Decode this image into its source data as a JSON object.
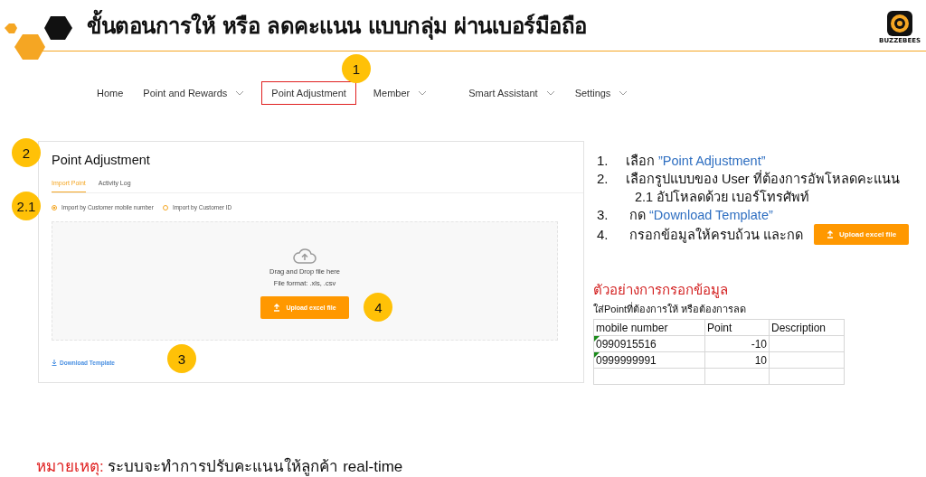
{
  "slide": {
    "title": "ขั้นตอนการให้ หรือ ลดคะแนน แบบกลุ่ม ผ่านเบอร์มือถือ",
    "logo": "BUZZEBEES"
  },
  "nav": [
    {
      "label": "Home",
      "dropdown": false,
      "highlighted": false
    },
    {
      "label": "Point and Rewards",
      "dropdown": true,
      "highlighted": false
    },
    {
      "label": "Point Adjustment",
      "dropdown": false,
      "highlighted": true,
      "callout": "1"
    },
    {
      "label": "Member",
      "dropdown": true,
      "highlighted": false
    },
    {
      "label": "Smart Assistant",
      "dropdown": true,
      "highlighted": false
    },
    {
      "label": "Settings",
      "dropdown": true,
      "highlighted": false
    }
  ],
  "panel": {
    "title": "Point Adjustment",
    "callout": "2",
    "tabs": [
      {
        "label": "Import Point",
        "selected": true
      },
      {
        "label": "Activity Log",
        "selected": false
      }
    ],
    "import_options": {
      "callout": "2.1",
      "options": [
        {
          "label": "Import by Customer mobile number",
          "selected": true
        },
        {
          "label": "Import by Customer ID",
          "selected": false
        }
      ]
    },
    "dropzone": {
      "text": "Drag and Drop file here",
      "format": "File format: .xls, .csv",
      "button": "Upload excel file",
      "callout": "4"
    },
    "download": {
      "label": "Download Template",
      "callout": "3"
    }
  },
  "steps": [
    {
      "number": "1.",
      "parts": [
        {
          "text": "เลือก ",
          "kind": "plain"
        },
        {
          "text": "”Point Adjustment”",
          "kind": "link"
        }
      ]
    },
    {
      "number": "2.",
      "parts": [
        {
          "text": "เลือกรูปแบบของ User ที่ต้องการอัพโหลดคะแนน",
          "kind": "plain"
        }
      ],
      "children": [
        {
          "text": "2.1 อัปโหลดด้วย เบอร์โทรศัพท์"
        }
      ]
    },
    {
      "number": "3.",
      "parts": [
        {
          "text": "กด ",
          "kind": "plain"
        },
        {
          "text": "“Download Template”",
          "kind": "link"
        }
      ]
    },
    {
      "number": "4.",
      "parts": [
        {
          "text": "กรอกข้อมูลให้ครบถ้วน และกด",
          "kind": "plain"
        }
      ],
      "button": "Upload excel file"
    }
  ],
  "example": {
    "heading": "ตัวอย่างการกรอกข้อมูล",
    "note": "ใส่Pointที่ต้องการให้ หรือต้องการลด",
    "columns": [
      "mobile number",
      "Point",
      "Description"
    ],
    "rows": [
      {
        "mobile_number": "0990915516",
        "point": "-10",
        "text_flag": true
      },
      {
        "mobile_number": "0999999991",
        "point": "10",
        "text_flag": true
      }
    ]
  },
  "footnote": {
    "label": "หมายเหตุ:",
    "text": "ระบบจะทำการปรับคะแนนให้ลูกค้า real-time"
  }
}
